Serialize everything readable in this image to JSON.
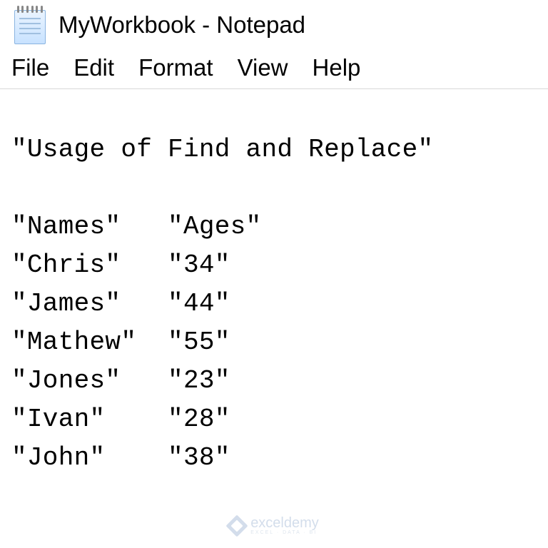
{
  "window": {
    "title": "MyWorkbook - Notepad"
  },
  "menu": {
    "file": "File",
    "edit": "Edit",
    "format": "Format",
    "view": "View",
    "help": "Help"
  },
  "document": {
    "lines": [
      "\"Usage of Find and Replace\"",
      "",
      "\"Names\"   \"Ages\"",
      "\"Chris\"   \"34\"",
      "\"James\"   \"44\"",
      "\"Mathew\"  \"55\"",
      "\"Jones\"   \"23\"",
      "\"Ivan\"    \"28\"",
      "\"John\"    \"38\""
    ]
  },
  "watermark": {
    "brand": "exceldemy",
    "tagline": "EXCEL · DATA · BI"
  }
}
